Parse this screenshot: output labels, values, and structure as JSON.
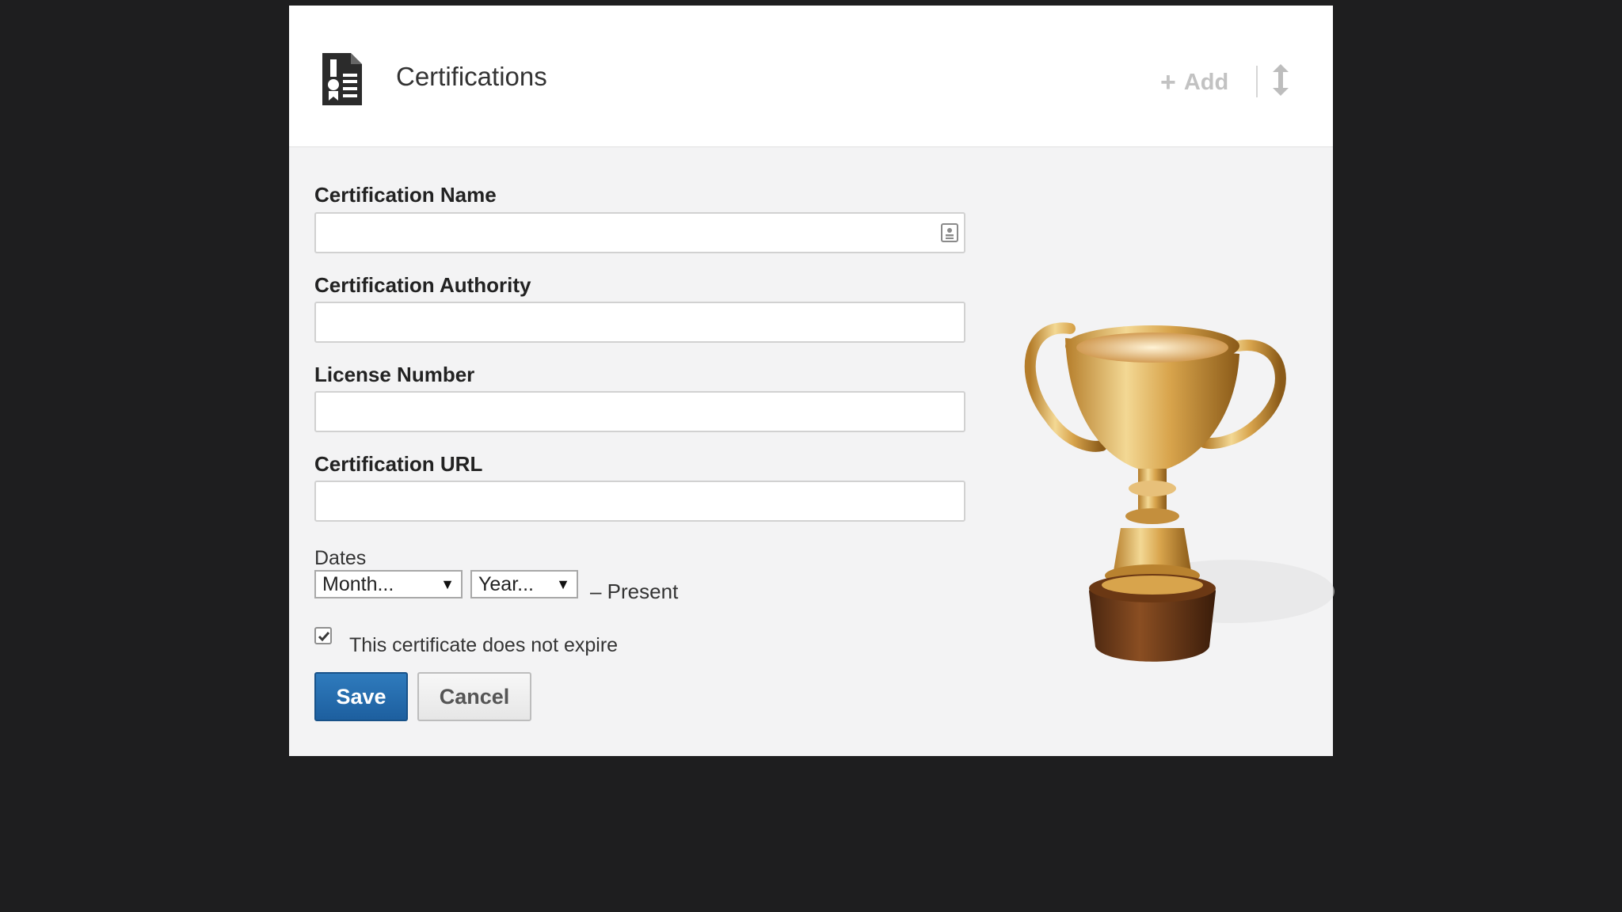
{
  "section": {
    "title": "Certifications",
    "add_label": "Add"
  },
  "form": {
    "name_label": "Certification Name",
    "name_value": "",
    "authority_label": "Certification Authority",
    "authority_value": "",
    "license_label": "License Number",
    "license_value": "",
    "url_label": "Certification URL",
    "url_value": "",
    "dates_label": "Dates",
    "month_selected": "Month...",
    "year_selected": "Year...",
    "present_text": "– Present",
    "no_expire_label": "This certificate does not expire",
    "no_expire_checked": true,
    "save_label": "Save",
    "cancel_label": "Cancel"
  },
  "icons": {
    "section": "certificate-document-icon",
    "add": "plus-icon",
    "reorder": "vertical-arrows-icon",
    "contact": "contact-card-icon",
    "dropdown": "triangle-down-icon",
    "illustration": "trophy-cup"
  },
  "colors": {
    "primary_button": "#2a70b0",
    "header_text": "#333333",
    "muted_action": "#c2c2c2",
    "background": "#1e1e1f",
    "panel": "#f3f3f4"
  }
}
